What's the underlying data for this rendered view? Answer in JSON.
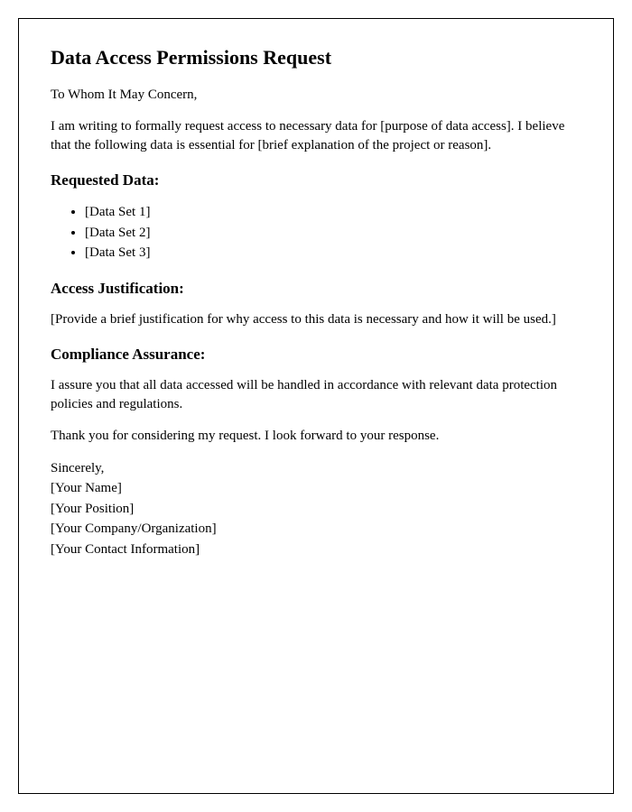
{
  "title": "Data Access Permissions Request",
  "salutation": "To Whom It May Concern,",
  "intro": "I am writing to formally request access to necessary data for [purpose of data access]. I believe that the following data is essential for [brief explanation of the project or reason].",
  "sections": {
    "requested_data": {
      "heading": "Requested Data:",
      "items": [
        "[Data Set 1]",
        "[Data Set 2]",
        "[Data Set 3]"
      ]
    },
    "justification": {
      "heading": "Access Justification:",
      "body": "[Provide a brief justification for why access to this data is necessary and how it will be used.]"
    },
    "compliance": {
      "heading": "Compliance Assurance:",
      "body": "I assure you that all data accessed will be handled in accordance with relevant data protection policies and regulations."
    }
  },
  "closing": "Thank you for considering my request. I look forward to your response.",
  "signature": {
    "valediction": "Sincerely,",
    "name": "[Your Name]",
    "position": "[Your Position]",
    "organization": "[Your Company/Organization]",
    "contact": "[Your Contact Information]"
  }
}
